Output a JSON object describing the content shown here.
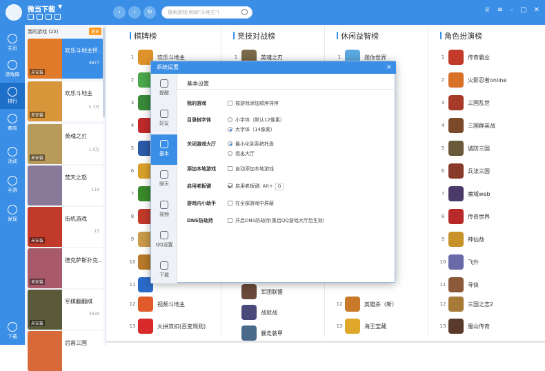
{
  "app": {
    "title": "微当下载",
    "search_placeholder": "搜索游戏(例如\"斗地主\")"
  },
  "sidebar": {
    "items": [
      {
        "label": "主页"
      },
      {
        "label": "游戏库"
      },
      {
        "label": "排行"
      },
      {
        "label": "商店"
      },
      {
        "label": "活动"
      },
      {
        "label": "手游"
      },
      {
        "label": "发现"
      },
      {
        "label": "下载"
      }
    ]
  },
  "mygames": {
    "header": "我的游戏 (25)",
    "badge": "更多",
    "cards": [
      {
        "name": "欢乐斗地主怀…",
        "size": "4677",
        "installed": "未安装",
        "color": "#e07a2a"
      },
      {
        "name": "欢乐斗地主",
        "size": "5.7万",
        "installed": "未安装",
        "color": "#d8953a"
      },
      {
        "name": "英魂之刃",
        "size": "1.9万",
        "installed": "未安装",
        "color": "#b89a5a"
      },
      {
        "name": "焚天之怒",
        "size": "119",
        "installed": "",
        "color": "#8a7a9a"
      },
      {
        "name": "街机游戏",
        "size": "13",
        "installed": "未安装",
        "color": "#c23a2a"
      },
      {
        "name": "德克萨斯扑克…",
        "size": "",
        "installed": "未安装",
        "color": "#a85a6a"
      },
      {
        "name": "军棋翻翻棋",
        "size": "3639",
        "installed": "未安装",
        "color": "#5a5a3a"
      },
      {
        "name": "后裔三国",
        "size": "",
        "installed": "",
        "color": "#d86a3a"
      }
    ]
  },
  "columns": [
    {
      "title": "棋牌榜",
      "rows": [
        {
          "rank": "1",
          "name": "欢乐斗地主",
          "color": "#e0922a"
        },
        {
          "rank": "2",
          "name": "",
          "color": "#4aa84a"
        },
        {
          "rank": "3",
          "name": "",
          "color": "#3a8a3a"
        },
        {
          "rank": "4",
          "name": "",
          "color": "#c22a2a"
        },
        {
          "rank": "5",
          "name": "",
          "color": "#2a5aa8"
        },
        {
          "rank": "6",
          "name": "",
          "color": "#d8a02a"
        },
        {
          "rank": "7",
          "name": "",
          "color": "#3a8a2a"
        },
        {
          "rank": "8",
          "name": "",
          "color": "#c23a2a"
        },
        {
          "rank": "9",
          "name": "",
          "color": "#c89a4a"
        },
        {
          "rank": "10",
          "name": "",
          "color": "#b87a2a"
        },
        {
          "rank": "11",
          "name": "",
          "color": "#2a6ac8"
        },
        {
          "rank": "12",
          "name": "视频斗地主",
          "color": "#e05a2a"
        },
        {
          "rank": "13",
          "name": "火拼双扣(百变规则)",
          "color": "#d82a2a"
        }
      ]
    },
    {
      "title": "竞技对战榜",
      "rows": [
        {
          "rank": "1",
          "name": "英魂之刃",
          "color": "#7a6a4a"
        },
        {
          "rank": "",
          "name": "军团联盟",
          "color": "#6a4a3a"
        },
        {
          "rank": "",
          "name": "战就战",
          "color": "#4a4a7a"
        },
        {
          "rank": "",
          "name": "暴走装甲",
          "color": "#4a6a8a"
        }
      ]
    },
    {
      "title": "休闲益智榜",
      "rows": [
        {
          "rank": "1",
          "name": "迷你世界",
          "color": "#5aa8e0"
        },
        {
          "rank": "12",
          "name": "英雄杀（新）",
          "color": "#c87a2a"
        },
        {
          "rank": "13",
          "name": "海王宝藏",
          "color": "#e0a82a"
        }
      ]
    },
    {
      "title": "角色扮演榜",
      "rows": [
        {
          "rank": "1",
          "name": "传奇霸业",
          "color": "#c23a2a"
        },
        {
          "rank": "2",
          "name": "火影忍者online",
          "color": "#d8702a"
        },
        {
          "rank": "3",
          "name": "三国乱世",
          "color": "#a83a2a"
        },
        {
          "rank": "4",
          "name": "三国群英战",
          "color": "#7a4a2a"
        },
        {
          "rank": "5",
          "name": "城防三国",
          "color": "#6a5a3a"
        },
        {
          "rank": "6",
          "name": "兵法三国",
          "color": "#8a3a2a"
        },
        {
          "rank": "7",
          "name": "魔域web",
          "color": "#4a3a6a"
        },
        {
          "rank": "8",
          "name": "传奇世界",
          "color": "#b82a2a"
        },
        {
          "rank": "9",
          "name": "神仙劫",
          "color": "#c8922a"
        },
        {
          "rank": "10",
          "name": "飞升",
          "color": "#6a6aa8"
        },
        {
          "rank": "11",
          "name": "寻侠",
          "color": "#8a5a3a"
        },
        {
          "rank": "12",
          "name": "三国之志2",
          "color": "#a87a3a"
        },
        {
          "rank": "13",
          "name": "蜀山传奇",
          "color": "#5a3a2a"
        }
      ]
    }
  ],
  "modal": {
    "title": "系统设置",
    "close": "×",
    "section_title": "基本设置",
    "tabs": [
      {
        "label": "提醒"
      },
      {
        "label": "好友"
      },
      {
        "label": "基本"
      },
      {
        "label": "聊天"
      },
      {
        "label": "视频"
      },
      {
        "label": "QQ设置"
      },
      {
        "label": "下载"
      }
    ],
    "settings": {
      "my_games": {
        "label": "我的游戏",
        "option": "按游戏添加顺序排序"
      },
      "font": {
        "label": "目录树字体",
        "small": "小字体（默认12像素）",
        "large": "大字体（14像素）"
      },
      "close_hall": {
        "label": "关闭游戏大厅",
        "minimize": "最小化到系统托盘",
        "exit": "退出大厅"
      },
      "add_local": {
        "label": "添加本地游戏",
        "option": "自动添加本地游戏"
      },
      "boss_key": {
        "label": "启用老板键",
        "option": "启用老板键: Alt+",
        "key": "Q"
      },
      "assistant": {
        "label": "游戏内小助手",
        "option": "在全部游戏中屏蔽"
      },
      "dns": {
        "label": "DNS防劫持",
        "option": "开启DNS防劫持(重启QQ游戏大厅后生效)"
      }
    }
  }
}
